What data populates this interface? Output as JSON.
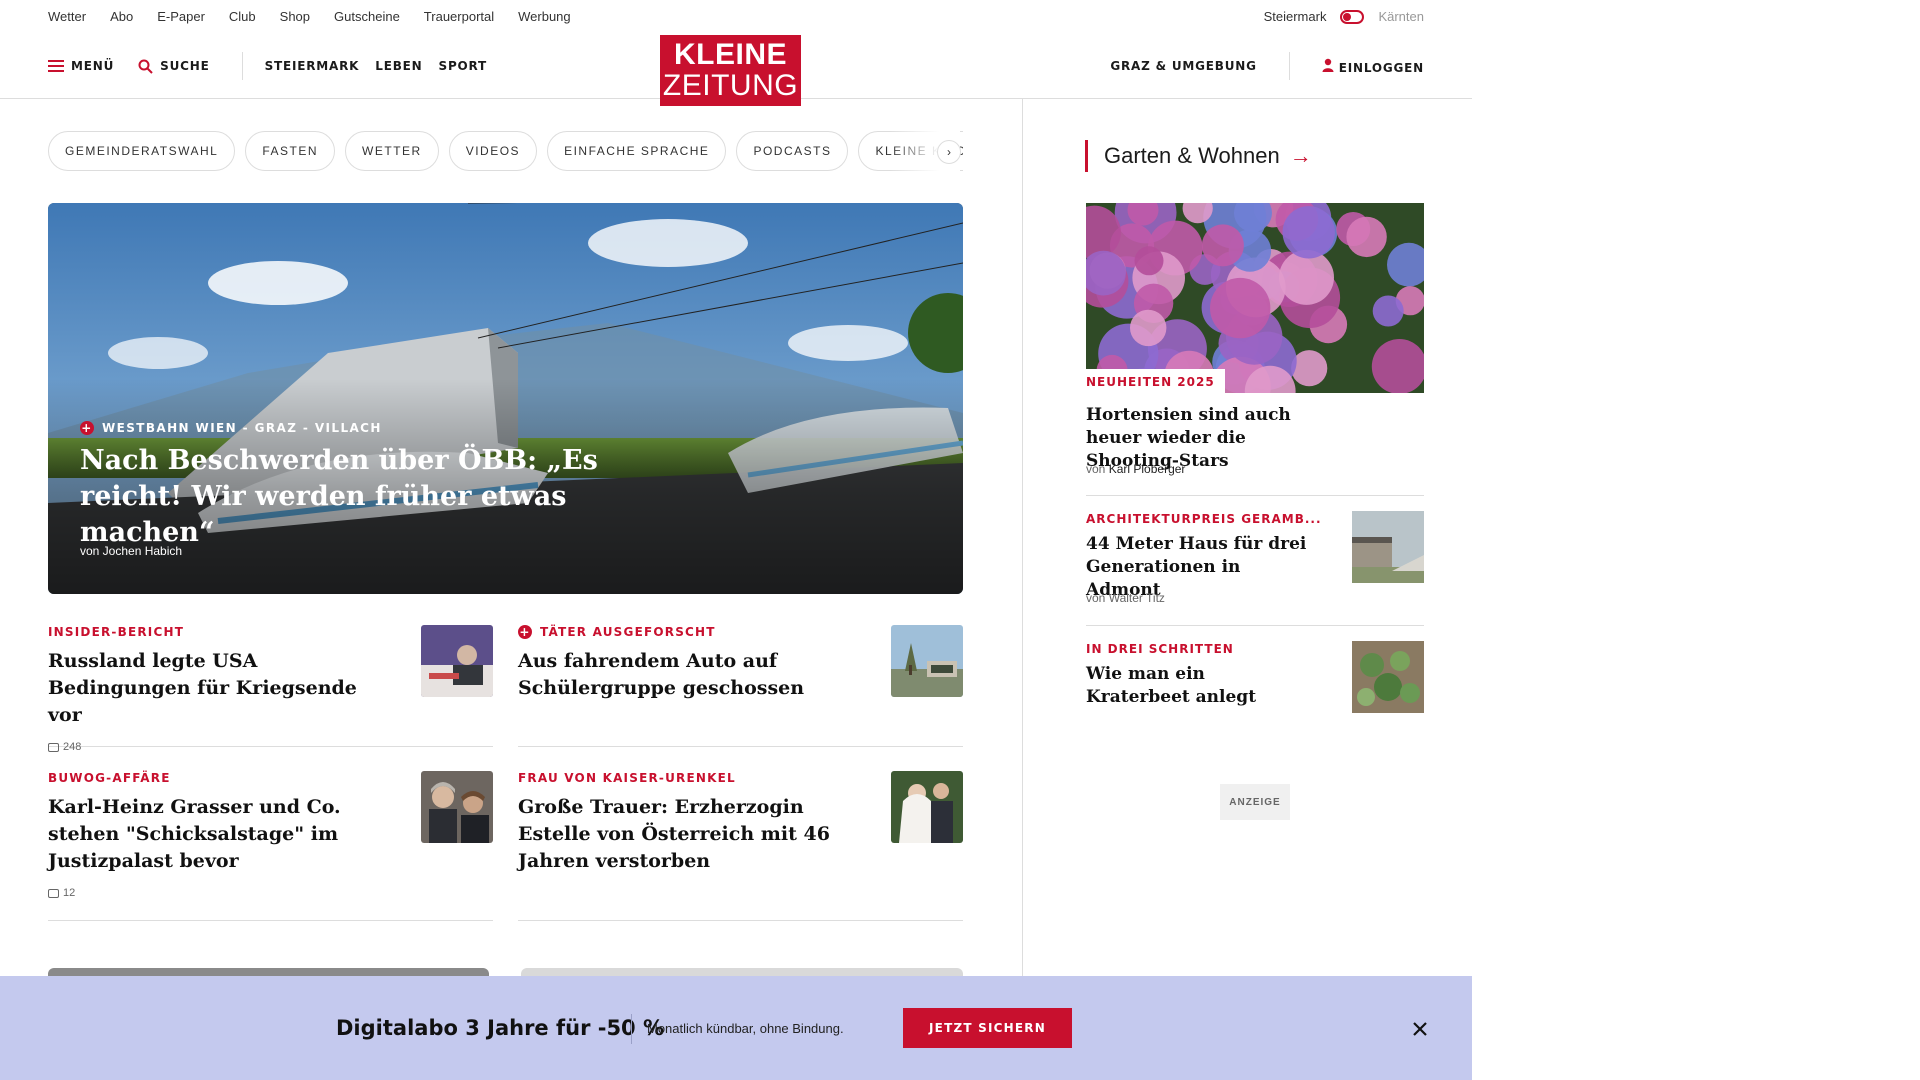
{
  "utility_links": [
    "Wetter",
    "Abo",
    "E-Paper",
    "Club",
    "Shop",
    "Gutscheine",
    "Trauerportal",
    "Werbung"
  ],
  "region": {
    "left": "Steiermark",
    "right": "Kärnten"
  },
  "header": {
    "menu": "MENÜ",
    "search": "SUCHE",
    "nav": [
      "STEIERMARK",
      "LEBEN",
      "SPORT"
    ],
    "logo_line1": "KLEINE",
    "logo_line2": "ZEITUNG",
    "location": "GRAZ & UMGEBUNG",
    "login": "EINLOGGEN"
  },
  "chips": [
    "GEMEINDERATSWAHL",
    "FASTEN",
    "WETTER",
    "VIDEOS",
    "EINFACHE SPRACHE",
    "PODCASTS",
    "KLEINE KINDE"
  ],
  "chips_next": "›",
  "hero": {
    "kicker": "WESTBAHN WIEN - GRAZ - VILLACH",
    "title": "Nach Beschwerden über ÖBB: „Es reicht! Wir werden früher etwas machen“",
    "author": "von Jochen Habich"
  },
  "articles": [
    {
      "kicker": "INSIDER-BERICHT",
      "title": "Russland legte USA Bedingungen für Kriegsende vor",
      "comments": "248",
      "plus": false
    },
    {
      "kicker": "TÄTER AUSGEFORSCHT",
      "title": "Aus fahrendem Auto auf Schülergruppe geschossen",
      "comments": "",
      "plus": true
    },
    {
      "kicker": "BUWOG-AFFÄRE",
      "title": "Karl-Heinz Grasser und Co. stehen \"Schicksalstage\" im Justizpalast bevor",
      "comments": "12",
      "plus": false
    },
    {
      "kicker": "FRAU VON KAISER-URENKEL",
      "title": "Große Trauer: Erzherzogin Estelle von Österreich mit 46 Jahren verstorben",
      "comments": "",
      "plus": false
    }
  ],
  "sidebar": {
    "section_title": "Garten & Wohnen",
    "section_arrow": "→",
    "items": [
      {
        "kicker": "NEUHEITEN 2025",
        "title": "Hortensien sind auch heuer wieder die Shooting-Stars",
        "author_prefix": "von",
        "author": "Karl Ploberger"
      },
      {
        "kicker": "ARCHITEKTURPREIS GERAMB...",
        "title": "44 Meter Haus für drei Generationen in Admont",
        "author_prefix": "von",
        "author": "Walter Titz"
      },
      {
        "kicker": "IN DREI SCHRITTEN",
        "title": "Wie man ein Kraterbeet anlegt",
        "author_prefix": "",
        "author": ""
      }
    ],
    "ad_label": "ANZEIGE"
  },
  "banner": {
    "headline": "Digitalabo 3 Jahre für -50 %",
    "subtext": "Monatlich kündbar, ohne Bindung.",
    "cta": "JETZT SICHERN"
  },
  "colors": {
    "brand_red": "#c8102e",
    "banner_bg": "#c4c9ee"
  }
}
